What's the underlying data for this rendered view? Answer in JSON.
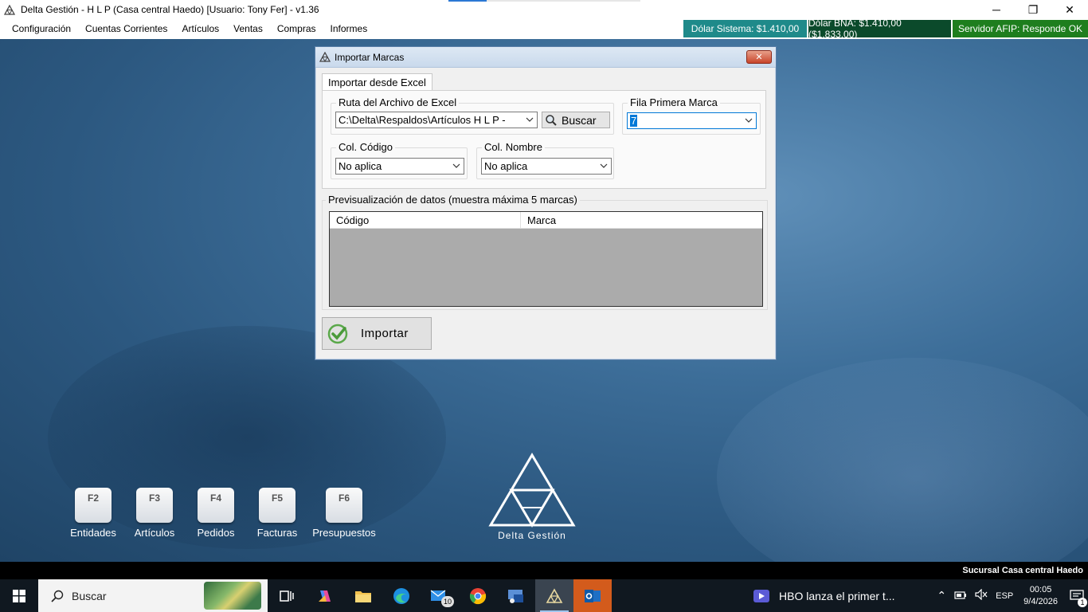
{
  "window": {
    "title": "Delta Gestión - H L P (Casa central Haedo) [Usuario: Tony Fer] - v1.36",
    "minimize": "─",
    "restore": "❐",
    "close": "✕"
  },
  "menu": [
    "Configuración",
    "Cuentas Corrientes",
    "Artículos",
    "Ventas",
    "Compras",
    "Informes"
  ],
  "status": {
    "dolar_sistema": "Dólar Sistema: $1.410,00",
    "dolar_bna": "Dólar BNA: $1.410,00 ($1.833,00)",
    "servidor_afip": "Servidor AFIP:  Responde OK"
  },
  "dialog": {
    "title": "Importar Marcas",
    "close_label": "✕",
    "tab_label": "Importar desde Excel",
    "ruta_label": "Ruta del Archivo de Excel",
    "ruta_value": "C:\\Delta\\Respaldos\\Artículos H L P - ",
    "buscar_label": "Buscar",
    "fila_label": "Fila Primera Marca",
    "fila_value": "7",
    "col_codigo_label": "Col. Código",
    "col_codigo_value": "No aplica",
    "col_nombre_label": "Col. Nombre",
    "col_nombre_value": "No aplica",
    "preview_label": "Previsualización de datos (muestra máxima 5 marcas)",
    "grid_columns": [
      "Código",
      "Marca"
    ],
    "importar_label": "Importar"
  },
  "fkeys": [
    {
      "key": "F2",
      "label": "Entidades"
    },
    {
      "key": "F3",
      "label": "Artículos"
    },
    {
      "key": "F4",
      "label": "Pedidos"
    },
    {
      "key": "F5",
      "label": "Facturas"
    },
    {
      "key": "F6",
      "label": "Presupuestos"
    }
  ],
  "logo_text": "Delta Gestión",
  "sucursal": "Sucursal Casa central Haedo",
  "taskbar": {
    "search_placeholder": "Buscar",
    "mail_badge": "10",
    "news": "HBO lanza el primer t...",
    "lang": "ESP",
    "time": "00:05",
    "date": "9/4/2026",
    "notif_count": "1"
  }
}
